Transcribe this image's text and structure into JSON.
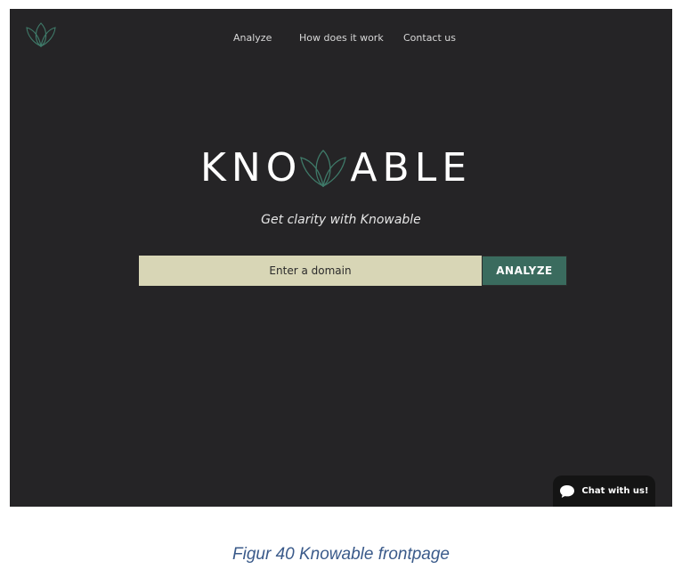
{
  "nav": {
    "items": [
      "Analyze",
      "How does it work",
      "Contact us"
    ]
  },
  "hero": {
    "wordmark_left": "KNO",
    "wordmark_right": "ABLE",
    "tagline": "Get clarity with Knowable"
  },
  "search": {
    "placeholder": "Enter a domain",
    "value": "",
    "button_label": "ANALYZE"
  },
  "chat": {
    "label": "Chat with us!"
  },
  "caption": "Figur 40 Knowable frontpage",
  "colors": {
    "background": "#252426",
    "input_bg": "#d8d6b6",
    "accent": "#3a6b5e",
    "logo_stroke": "#3f7a69",
    "caption": "#3a5a8a"
  },
  "icons": {
    "logo": "lotus-logo-icon",
    "wordmark_w": "lotus-w-icon",
    "chat": "chat-bubble-icon"
  }
}
